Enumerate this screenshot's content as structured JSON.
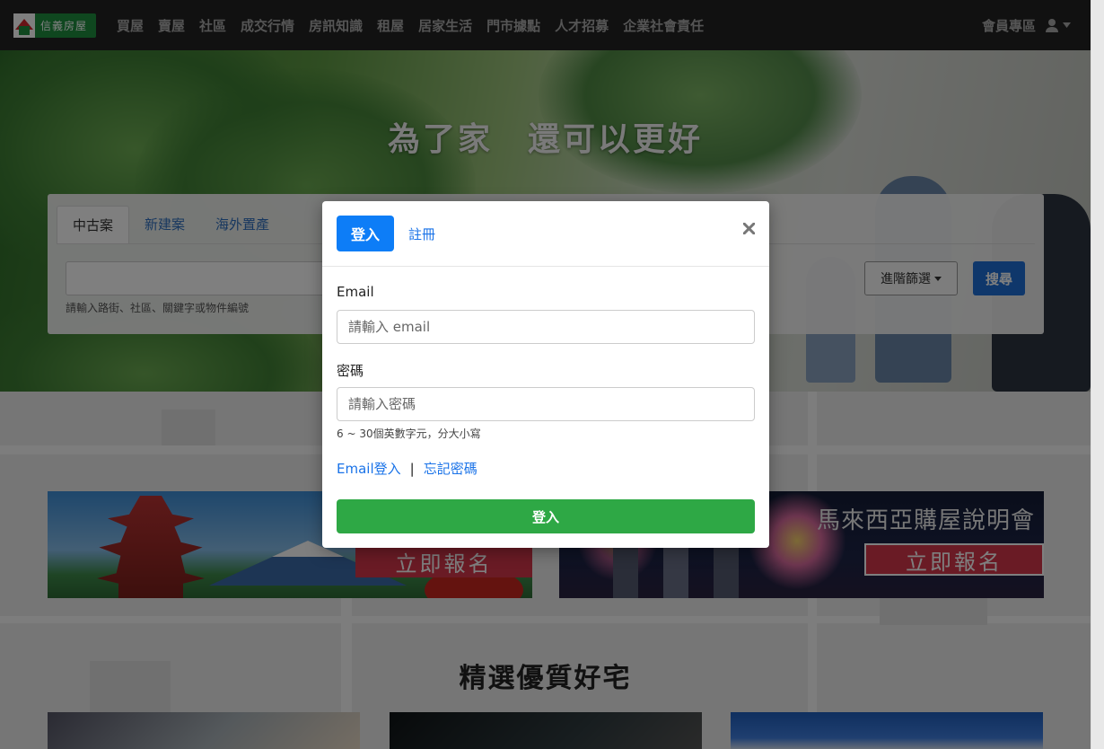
{
  "brand": {
    "logo_text": "信義房屋",
    "logo_green": "#1e8e3e",
    "logo_red": "#d0272c"
  },
  "nav": {
    "links": [
      "買屋",
      "賣屋",
      "社區",
      "成交行情",
      "房訊知識",
      "租屋",
      "居家生活",
      "門市據點",
      "人才招募",
      "企業社會責任"
    ],
    "member_label": "會員專區",
    "user_icon": "user-icon",
    "caret_icon": "caret-down-icon"
  },
  "hero": {
    "title": "為了家　還可以更好",
    "search": {
      "tabs": [
        "中古案",
        "新建案",
        "海外置產"
      ],
      "active_tab": "中古案",
      "hint": "請輸入路街、社區、關鍵字或物件編號",
      "advanced_label": "進階篩選",
      "search_label": "搜尋"
    }
  },
  "banners": [
    {
      "title": "",
      "cta": "立即報名"
    },
    {
      "title": "馬來西亞購屋說明會",
      "cta": "立即報名"
    }
  ],
  "featured": {
    "title": "精選優質好宅"
  },
  "modal": {
    "tabs": {
      "login": "登入",
      "register": "註冊"
    },
    "close_icon": "close-icon",
    "email_label": "Email",
    "email_placeholder": "請輸入 email",
    "email_value": "",
    "password_label": "密碼",
    "password_placeholder": "請輸入密碼",
    "password_value": "",
    "password_hint": "6 ~ 30個英數字元，分大小寫",
    "email_login_link": "Email登入",
    "separator": "|",
    "forgot_link": "忘記密碼",
    "submit_label": "登入",
    "colors": {
      "primary": "#0d7df7",
      "success": "#2ea845",
      "link": "#1a73e8"
    }
  }
}
